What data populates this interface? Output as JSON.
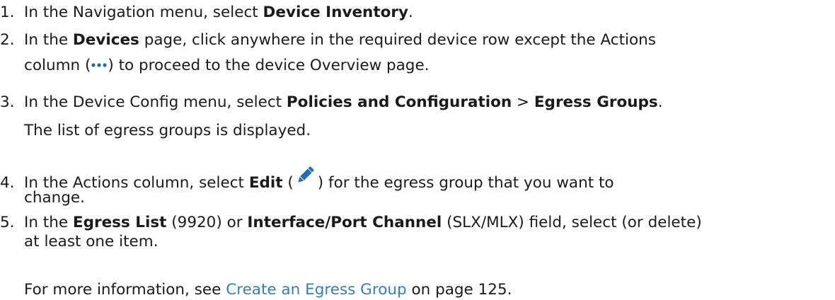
{
  "steps": [
    {
      "num": "1.",
      "t1": "In the Navigation menu, select ",
      "b1": "Device Inventory",
      "t2": "."
    },
    {
      "num": "2.",
      "t1": "In the ",
      "b1": "Devices",
      "t2": " page, click anywhere in the required device row except the Actions",
      "line2_pre": "column (",
      "line2_post": ") to proceed to the device Overview page."
    },
    {
      "num": "3.",
      "t1": "In the Device Config menu, select ",
      "b1": "Policies and Configuration",
      "t2": " > ",
      "b2": "Egress Groups",
      "t3": ".",
      "note": "The list of egress groups is displayed."
    },
    {
      "num": "4.",
      "t1": "In the Actions column, select ",
      "b1": "Edit",
      "t2": " (",
      "t3": ") for the egress group that you want to",
      "line2": "change."
    },
    {
      "num": "5.",
      "t1": "In the ",
      "b1": "Egress List",
      "t2": " (9920) or ",
      "b2": "Interface/Port Channel",
      "t3": " (SLX/MLX) field, select (or delete)",
      "line2": "at least one item.",
      "note_pre": "For more information, see ",
      "note_link": "Create an Egress Group",
      "note_post": " on page 125."
    }
  ],
  "icons": {
    "actions": "more-dots-icon",
    "edit": "pencil-edit-icon"
  },
  "colors": {
    "text": "#1a1a1a",
    "link": "#2f7fc4",
    "icon": "#1f6fb8"
  }
}
